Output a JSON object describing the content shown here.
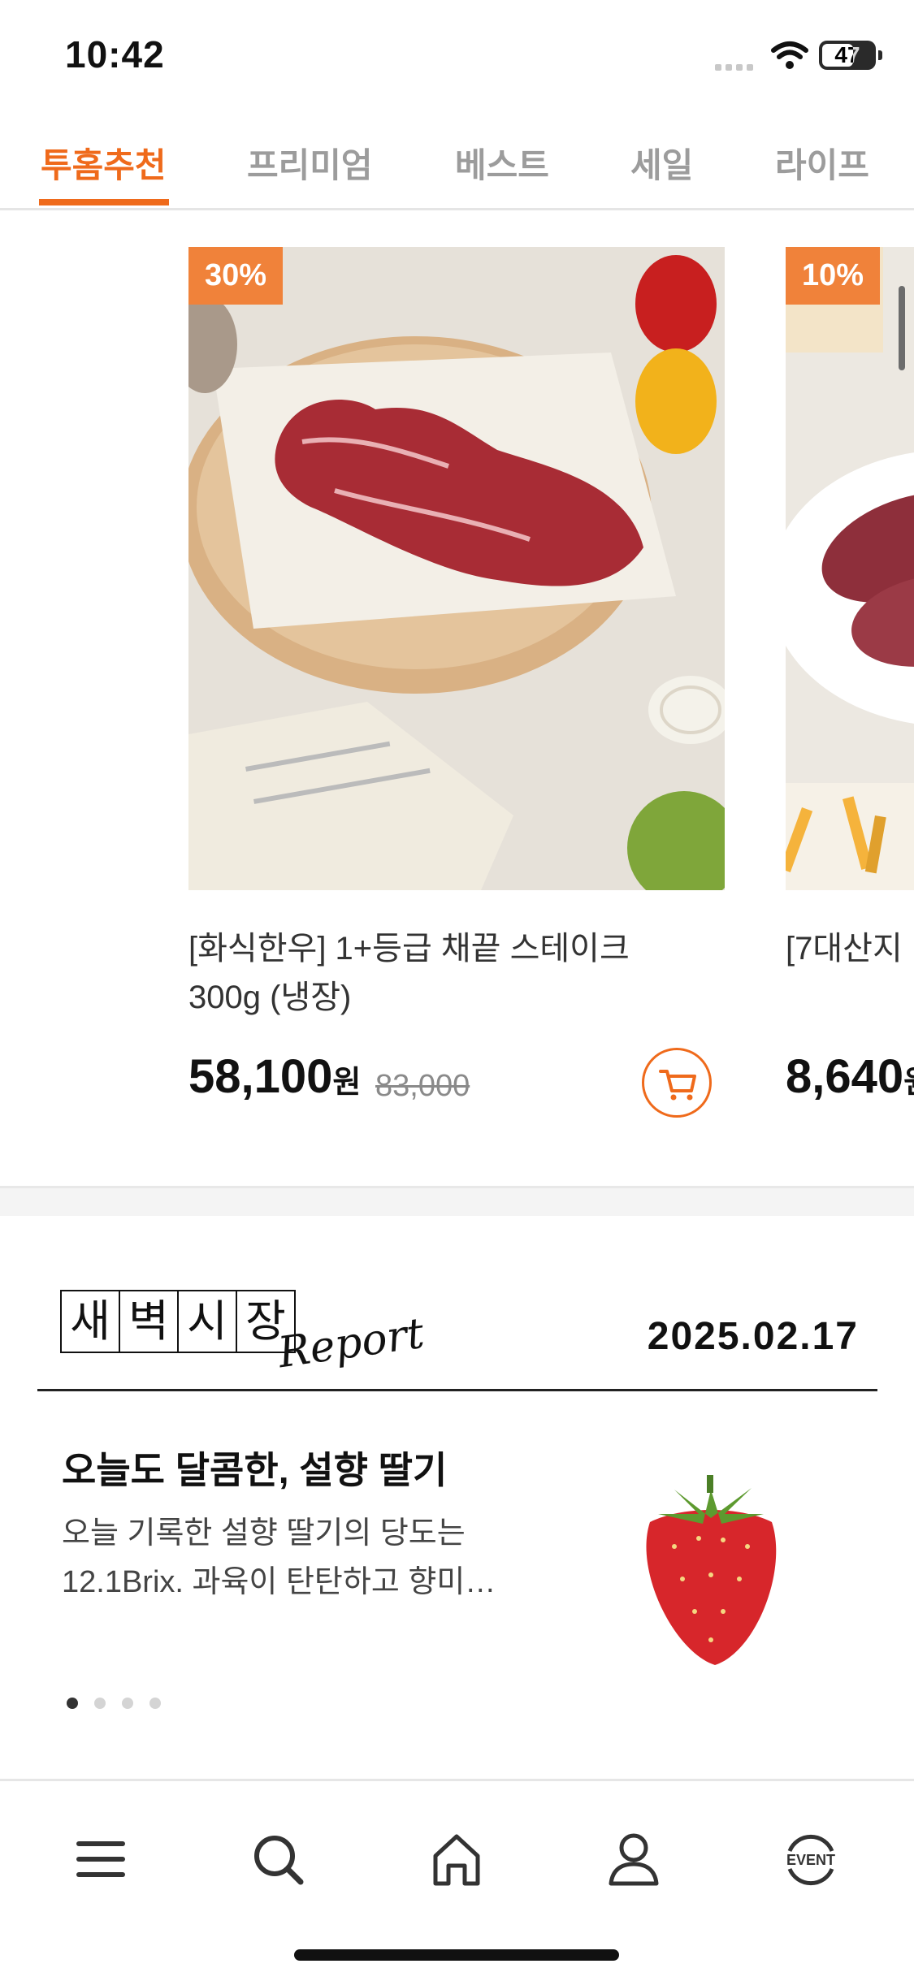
{
  "status_bar": {
    "time": "10:42",
    "battery": "47"
  },
  "tabs": [
    {
      "label": "투홈추천",
      "active": true
    },
    {
      "label": "프리미엄",
      "active": false
    },
    {
      "label": "베스트",
      "active": false
    },
    {
      "label": "세일",
      "active": false
    },
    {
      "label": "라이프",
      "active": false
    }
  ],
  "products": [
    {
      "badge": "30%",
      "title_line1": "[화식한우] 1+등급 채끝 스테이크",
      "title_line2": "300g (냉장)",
      "price": "58,100",
      "currency": "원",
      "original_price": "83,000"
    },
    {
      "badge": "10%",
      "title_line1": "[7대산지",
      "price": "8,640",
      "currency": "원"
    }
  ],
  "report": {
    "logo_chars": [
      "새",
      "벽",
      "시",
      "장"
    ],
    "logo_script": "Report",
    "date": "2025.02.17",
    "headline": "오늘도 달콤한, 설향 딸기",
    "desc_line1": "오늘 기록한 설향 딸기의 당도는",
    "desc_line2": "12.1Brix. 과육이 탄탄하고 향미…",
    "page_total": 4,
    "page_current": 1
  },
  "bottom_nav": {
    "items": [
      "menu-icon",
      "search-icon",
      "home-icon",
      "profile-icon",
      "event-icon"
    ],
    "event_label": "EVENT"
  },
  "colors": {
    "accent": "#ef6a1b",
    "badge": "#f0823a"
  }
}
